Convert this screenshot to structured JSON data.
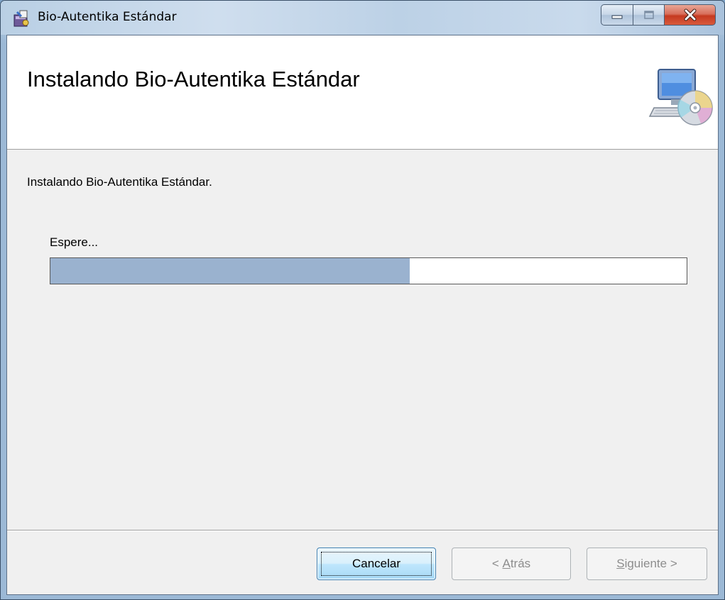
{
  "window": {
    "title": "Bio-Autentika Estándar",
    "icon": "installer-package-icon"
  },
  "caption_buttons": {
    "minimize_icon": "minimize-icon",
    "maximize_icon": "maximize-icon",
    "close_icon": "close-icon"
  },
  "banner": {
    "title": "Instalando Bio-Autentika Estándar",
    "icon": "computer-disc-icon"
  },
  "body": {
    "status_text": "Instalando Bio-Autentika Estándar."
  },
  "progress": {
    "label": "Espere...",
    "fraction": 0.565,
    "fill_color": "#9ab2cf"
  },
  "buttons": {
    "cancel": {
      "label": "Cancelar"
    },
    "back": {
      "prefix": "< ",
      "accel": "A",
      "rest": "trás"
    },
    "next": {
      "accel": "S",
      "rest": "iguiente >"
    }
  }
}
